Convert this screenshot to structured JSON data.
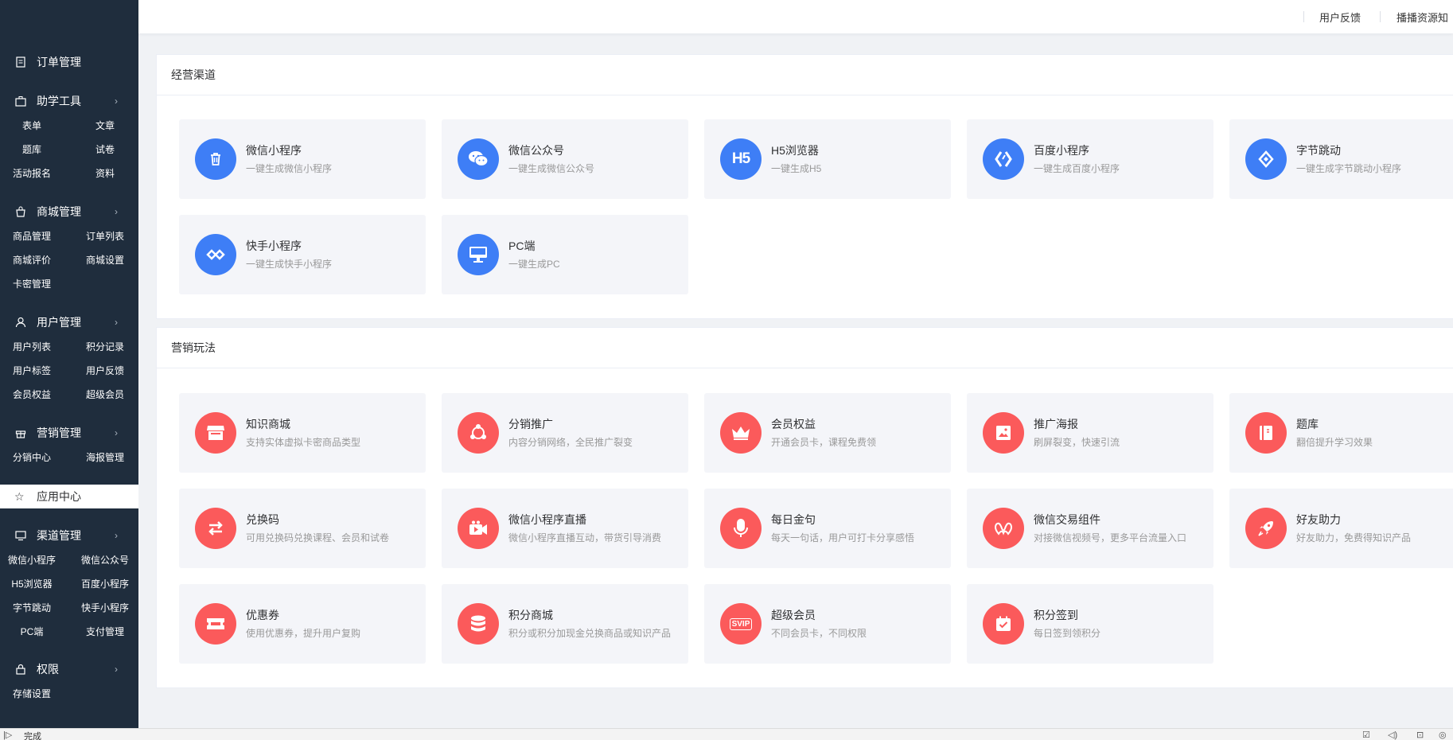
{
  "sidebar": {
    "order": {
      "label": "订单管理"
    },
    "study": {
      "label": "助学工具",
      "items": [
        "表单",
        "文章",
        "题库",
        "试卷",
        "活动报名",
        "资料"
      ]
    },
    "mall": {
      "label": "商城管理",
      "items": [
        "商品管理",
        "订单列表",
        "商城评价",
        "商城设置",
        "卡密管理"
      ]
    },
    "user": {
      "label": "用户管理",
      "items": [
        "用户列表",
        "积分记录",
        "用户标签",
        "用户反馈",
        "会员权益",
        "超级会员"
      ]
    },
    "marketing": {
      "label": "营销管理",
      "items": [
        "分销中心",
        "海报管理"
      ]
    },
    "appcenter": {
      "label": "应用中心"
    },
    "channel": {
      "label": "渠道管理",
      "items": [
        "微信小程序",
        "微信公众号",
        "H5浏览器",
        "百度小程序",
        "字节跳动",
        "快手小程序",
        "PC端",
        "支付管理"
      ]
    },
    "perm": {
      "label": "权限",
      "items": [
        "存储设置"
      ]
    }
  },
  "topbar": {
    "links": [
      "用户反馈",
      "播播资源知"
    ]
  },
  "channels": {
    "title": "经营渠道",
    "cards": [
      {
        "title": "微信小程序",
        "desc": "一键生成微信小程序",
        "icon": "trash-icon"
      },
      {
        "title": "微信公众号",
        "desc": "一键生成微信公众号",
        "icon": "wechat-icon"
      },
      {
        "title": "H5浏览器",
        "desc": "一键生成H5",
        "icon": "h5-icon",
        "glyph": "H5"
      },
      {
        "title": "百度小程序",
        "desc": "一键生成百度小程序",
        "icon": "baidu-icon"
      },
      {
        "title": "字节跳动",
        "desc": "一键生成字节跳动小程序",
        "icon": "bytedance-icon"
      },
      {
        "title": "快手小程序",
        "desc": "一键生成快手小程序",
        "icon": "kuaishou-icon"
      },
      {
        "title": "PC端",
        "desc": "一键生成PC",
        "icon": "monitor-icon"
      }
    ]
  },
  "marketing": {
    "title": "营销玩法",
    "cards": [
      {
        "title": "知识商城",
        "desc": "支持实体虚拟卡密商品类型",
        "icon": "store-icon"
      },
      {
        "title": "分销推广",
        "desc": "内容分销网络，全民推广裂变",
        "icon": "share-network-icon"
      },
      {
        "title": "会员权益",
        "desc": "开通会员卡，课程免费领",
        "icon": "crown-icon"
      },
      {
        "title": "推广海报",
        "desc": "刷屏裂变，快速引流",
        "icon": "poster-icon"
      },
      {
        "title": "题库",
        "desc": "翻倍提升学习效果",
        "icon": "question-book-icon"
      },
      {
        "title": "兑换码",
        "desc": "可用兑换码兑换课程、会员和试卷",
        "icon": "exchange-icon"
      },
      {
        "title": "微信小程序直播",
        "desc": "微信小程序直播互动，带货引导消费",
        "icon": "live-camera-icon"
      },
      {
        "title": "每日金句",
        "desc": "每天一句话，用户可打卡分享感悟",
        "icon": "microphone-icon"
      },
      {
        "title": "微信交易组件",
        "desc": "对接微信视频号，更多平台流量入口",
        "icon": "trade-component-icon"
      },
      {
        "title": "好友助力",
        "desc": "好友助力，免费得知识产品",
        "icon": "rocket-icon"
      },
      {
        "title": "优惠券",
        "desc": "使用优惠券，提升用户复购",
        "icon": "coupon-icon"
      },
      {
        "title": "积分商城",
        "desc": "积分或积分加现金兑换商品或知识产品",
        "icon": "points-coins-icon"
      },
      {
        "title": "超级会员",
        "desc": "不同会员卡，不同权限",
        "icon": "svip-icon",
        "glyph": "SVIP"
      },
      {
        "title": "积分签到",
        "desc": "每日签到领积分",
        "icon": "calendar-check-icon"
      }
    ]
  },
  "statusbar": {
    "text": "完成"
  },
  "colors": {
    "sidebar": "#1f2d3d",
    "blue": "#3e7ef6",
    "red": "#fb5a5b",
    "card_bg": "#f4f5f9"
  }
}
